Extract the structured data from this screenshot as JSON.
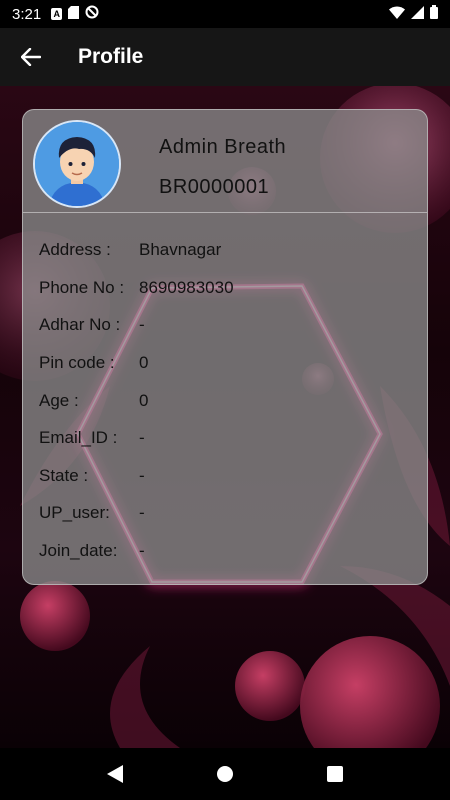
{
  "status_bar": {
    "time": "3:21",
    "icons": [
      "notification-a-icon",
      "sd-card-icon",
      "no-disturb-icon",
      "wifi-icon",
      "signal-icon",
      "battery-icon"
    ]
  },
  "app_bar": {
    "title": "Profile",
    "back_icon": "arrow-back-icon"
  },
  "profile": {
    "name": "Admin Breath",
    "user_id": "BR0000001",
    "fields": [
      {
        "label": "Address :",
        "value": "Bhavnagar"
      },
      {
        "label": "Phone No :",
        "value": "8690983030"
      },
      {
        "label": "Adhar No :",
        "value": "-"
      },
      {
        "label": "Pin code :",
        "value": "0"
      },
      {
        "label": "Age :",
        "value": "0"
      },
      {
        "label": "Email_ID :",
        "value": "-"
      },
      {
        "label": "State :",
        "value": "-"
      },
      {
        "label": "UP_user:",
        "value": "-"
      },
      {
        "label": "Join_date:",
        "value": "-"
      }
    ]
  },
  "colors": {
    "accent": "#ff2d8f",
    "card": "#8a8a8a",
    "avatar_bg": "#4e9be3"
  },
  "nav_bar": {
    "icons": [
      "back-triangle-icon",
      "home-circle-icon",
      "recents-square-icon"
    ]
  }
}
